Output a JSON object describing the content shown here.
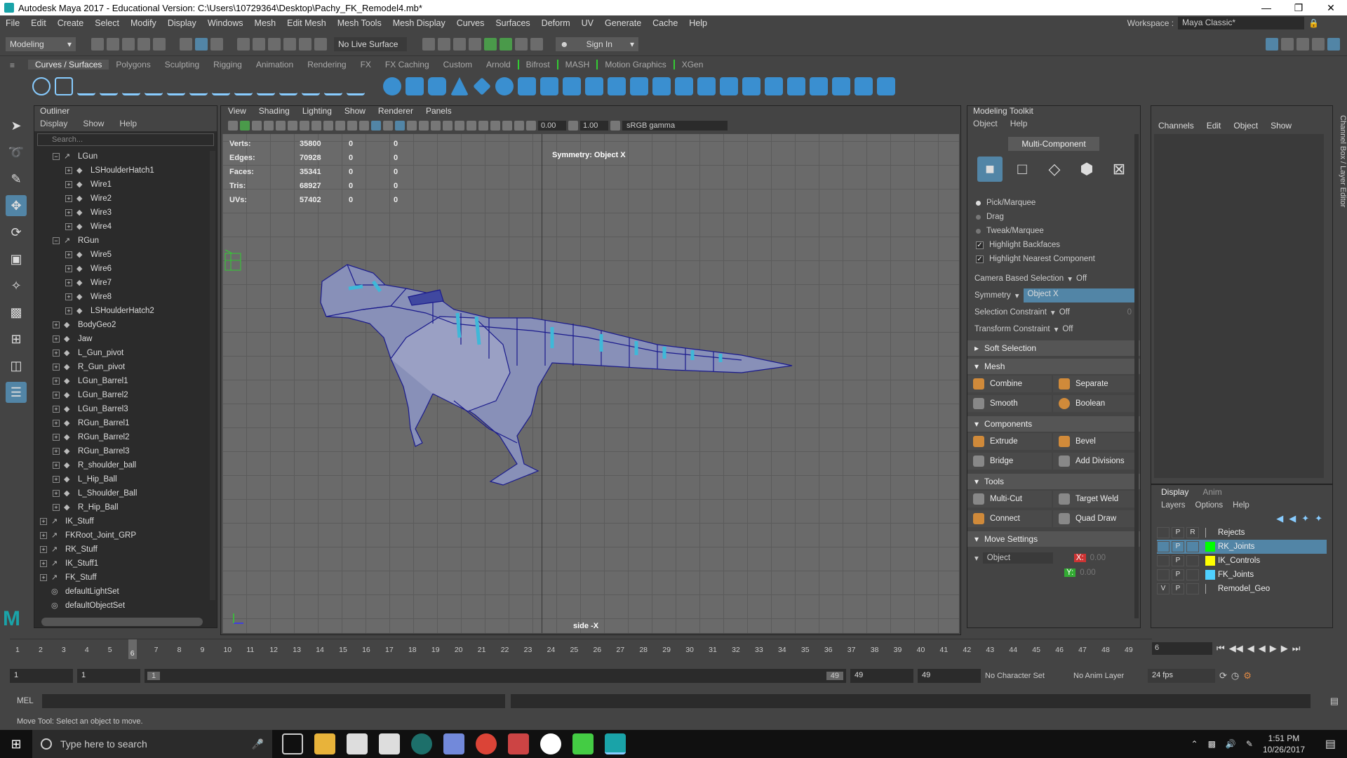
{
  "window": {
    "title": "Autodesk Maya 2017 - Educational Version: C:\\Users\\10729364\\Desktop\\Pachy_FK_Remodel4.mb*"
  },
  "menubar": {
    "items": [
      "File",
      "Edit",
      "Create",
      "Select",
      "Modify",
      "Display",
      "Windows",
      "Mesh",
      "Edit Mesh",
      "Mesh Tools",
      "Mesh Display",
      "Curves",
      "Surfaces",
      "Deform",
      "UV",
      "Generate",
      "Cache",
      "Help"
    ],
    "workspace_label": "Workspace :",
    "workspace_value": "Maya Classic*"
  },
  "statusline": {
    "mode": "Modeling",
    "live_surface": "No Live Surface",
    "sign_in": "Sign In"
  },
  "shelf": {
    "tabs": [
      "Curves / Surfaces",
      "Polygons",
      "Sculpting",
      "Rigging",
      "Animation",
      "Rendering",
      "FX",
      "FX Caching",
      "Custom",
      "Arnold",
      "Bifrost",
      "MASH",
      "Motion Graphics",
      "XGen"
    ],
    "active_tab": "Curves / Surfaces"
  },
  "outliner": {
    "title": "Outliner",
    "menu": [
      "Display",
      "Show",
      "Help"
    ],
    "search_placeholder": "Search...",
    "items": [
      {
        "label": "LGun",
        "depth": 1,
        "expand": "−",
        "icon": "joint"
      },
      {
        "label": "LSHoulderHatch1",
        "depth": 2,
        "expand": "+",
        "icon": "mesh"
      },
      {
        "label": "Wire1",
        "depth": 2,
        "expand": "+",
        "icon": "mesh"
      },
      {
        "label": "Wire2",
        "depth": 2,
        "expand": "+",
        "icon": "mesh"
      },
      {
        "label": "Wire3",
        "depth": 2,
        "expand": "+",
        "icon": "mesh"
      },
      {
        "label": "Wire4",
        "depth": 2,
        "expand": "+",
        "icon": "mesh"
      },
      {
        "label": "RGun",
        "depth": 1,
        "expand": "−",
        "icon": "joint"
      },
      {
        "label": "Wire5",
        "depth": 2,
        "expand": "+",
        "icon": "mesh"
      },
      {
        "label": "Wire6",
        "depth": 2,
        "expand": "+",
        "icon": "mesh"
      },
      {
        "label": "Wire7",
        "depth": 2,
        "expand": "+",
        "icon": "mesh"
      },
      {
        "label": "Wire8",
        "depth": 2,
        "expand": "+",
        "icon": "mesh"
      },
      {
        "label": "LSHoulderHatch2",
        "depth": 2,
        "expand": "+",
        "icon": "mesh"
      },
      {
        "label": "BodyGeo2",
        "depth": 1,
        "expand": "+",
        "icon": "mesh"
      },
      {
        "label": "Jaw",
        "depth": 1,
        "expand": "+",
        "icon": "mesh"
      },
      {
        "label": "L_Gun_pivot",
        "depth": 1,
        "expand": "+",
        "icon": "mesh"
      },
      {
        "label": "R_Gun_pivot",
        "depth": 1,
        "expand": "+",
        "icon": "mesh"
      },
      {
        "label": "LGun_Barrel1",
        "depth": 1,
        "expand": "+",
        "icon": "mesh"
      },
      {
        "label": "LGun_Barrel2",
        "depth": 1,
        "expand": "+",
        "icon": "mesh"
      },
      {
        "label": "LGun_Barrel3",
        "depth": 1,
        "expand": "+",
        "icon": "mesh"
      },
      {
        "label": "RGun_Barrel1",
        "depth": 1,
        "expand": "+",
        "icon": "mesh"
      },
      {
        "label": "RGun_Barrel2",
        "depth": 1,
        "expand": "+",
        "icon": "mesh"
      },
      {
        "label": "RGun_Barrel3",
        "depth": 1,
        "expand": "+",
        "icon": "mesh"
      },
      {
        "label": "R_shoulder_ball",
        "depth": 1,
        "expand": "+",
        "icon": "mesh"
      },
      {
        "label": "L_Hip_Ball",
        "depth": 1,
        "expand": "+",
        "icon": "mesh"
      },
      {
        "label": "L_Shoulder_Ball",
        "depth": 1,
        "expand": "+",
        "icon": "mesh"
      },
      {
        "label": "R_Hip_Ball",
        "depth": 1,
        "expand": "+",
        "icon": "mesh"
      },
      {
        "label": "IK_Stuff",
        "depth": 0,
        "expand": "+",
        "icon": "joint"
      },
      {
        "label": "FKRoot_Joint_GRP",
        "depth": 0,
        "expand": "+",
        "icon": "joint"
      },
      {
        "label": "RK_Stuff",
        "depth": 0,
        "expand": "+",
        "icon": "joint"
      },
      {
        "label": "IK_Stuff1",
        "depth": 0,
        "expand": "+",
        "icon": "joint"
      },
      {
        "label": "FK_Stuff",
        "depth": 0,
        "expand": "+",
        "icon": "joint"
      },
      {
        "label": "defaultLightSet",
        "depth": 0,
        "expand": "",
        "icon": "set"
      },
      {
        "label": "defaultObjectSet",
        "depth": 0,
        "expand": "",
        "icon": "set"
      }
    ]
  },
  "viewport": {
    "menu": [
      "View",
      "Shading",
      "Lighting",
      "Show",
      "Renderer",
      "Panels"
    ],
    "exposure": "0.00",
    "gamma": "1.00",
    "color_space": "sRGB gamma",
    "hud": [
      {
        "label": "Verts:",
        "value": "35800",
        "a": "0",
        "b": "0"
      },
      {
        "label": "Edges:",
        "value": "70928",
        "a": "0",
        "b": "0"
      },
      {
        "label": "Faces:",
        "value": "35341",
        "a": "0",
        "b": "0"
      },
      {
        "label": "Tris:",
        "value": "68927",
        "a": "0",
        "b": "0"
      },
      {
        "label": "UVs:",
        "value": "57402",
        "a": "0",
        "b": "0"
      }
    ],
    "symmetry": "Symmetry: Object X",
    "camera": "side -X"
  },
  "modeling_toolkit": {
    "title": "Modeling Toolkit",
    "menu": [
      "Object",
      "Help"
    ],
    "multi_component": "Multi-Component",
    "selection_modes": [
      "Pick/Marquee",
      "Drag",
      "Tweak/Marquee"
    ],
    "checks": [
      "Highlight Backfaces",
      "Highlight Nearest Component"
    ],
    "camera_based_selection": {
      "label": "Camera Based Selection",
      "value": "Off"
    },
    "symmetry": {
      "label": "Symmetry",
      "value": "Object X"
    },
    "selection_constraint": {
      "label": "Selection Constraint",
      "value": "Off",
      "num": "0"
    },
    "transform_constraint": {
      "label": "Transform Constraint",
      "value": "Off"
    },
    "soft_selection": "Soft Selection",
    "mesh_section": "Mesh",
    "mesh_buttons": [
      "Combine",
      "Separate",
      "Smooth",
      "Boolean"
    ],
    "components_section": "Components",
    "component_buttons": [
      "Extrude",
      "Bevel",
      "Bridge",
      "Add Divisions"
    ],
    "tools_section": "Tools",
    "tool_buttons": [
      "Multi-Cut",
      "Target Weld",
      "Connect",
      "Quad Draw"
    ],
    "move_settings": "Move Settings",
    "move_space": "Object",
    "move_x": {
      "label": "X:",
      "value": "0.00"
    },
    "move_y": {
      "label": "Y:",
      "value": "0.00"
    }
  },
  "channel_box": {
    "menu": [
      "Channels",
      "Edit",
      "Object",
      "Show"
    ],
    "side_label": "Channel Box / Layer Editor"
  },
  "layer_editor": {
    "tabs": [
      "Display",
      "Anim"
    ],
    "menu": [
      "Layers",
      "Options",
      "Help"
    ],
    "layers": [
      {
        "v": "",
        "p": "P",
        "r": "R",
        "color": "",
        "name": "Rejects",
        "selected": false
      },
      {
        "v": "",
        "p": "P",
        "r": "",
        "color": "#00ff00",
        "name": "RK_Joints",
        "selected": true
      },
      {
        "v": "",
        "p": "P",
        "r": "",
        "color": "#ffff00",
        "name": "IK_Controls",
        "selected": false
      },
      {
        "v": "",
        "p": "P",
        "r": "",
        "color": "#4fd0ff",
        "name": "FK_Joints",
        "selected": false
      },
      {
        "v": "V",
        "p": "P",
        "r": "",
        "color": "",
        "name": "Remodel_Geo",
        "selected": false
      }
    ]
  },
  "time_slider": {
    "ticks": [
      "1",
      "2",
      "3",
      "4",
      "5",
      "6",
      "7",
      "8",
      "9",
      "10",
      "11",
      "12",
      "13",
      "14",
      "15",
      "16",
      "17",
      "18",
      "19",
      "20",
      "21",
      "22",
      "23",
      "24",
      "25",
      "26",
      "27",
      "28",
      "29",
      "30",
      "31",
      "32",
      "33",
      "34",
      "35",
      "36",
      "37",
      "38",
      "39",
      "40",
      "41",
      "42",
      "43",
      "44",
      "45",
      "46",
      "47",
      "48",
      "49"
    ],
    "current_frame": "6"
  },
  "playback": {
    "current_frame": "6"
  },
  "range_slider": {
    "start": "1",
    "playback_start": "1",
    "range_start": "1",
    "range_end": "49",
    "playback_end": "49",
    "end": "49",
    "character_set": "No Character Set",
    "anim_layer": "No Anim Layer",
    "fps": "24 fps"
  },
  "command_line": {
    "label": "MEL"
  },
  "help_line": {
    "text": "Move Tool: Select an object to move."
  },
  "taskbar": {
    "search_placeholder": "Type here to search",
    "time": "1:51 PM",
    "date": "10/26/2017"
  },
  "colors": {
    "accent": "#5285a6",
    "panel": "#444444",
    "dark": "#2b2b2b",
    "mesh_wire": "#1a1a8c",
    "mesh_fill": "#8890b8",
    "mesh_stripe": "#3fb8d8"
  }
}
